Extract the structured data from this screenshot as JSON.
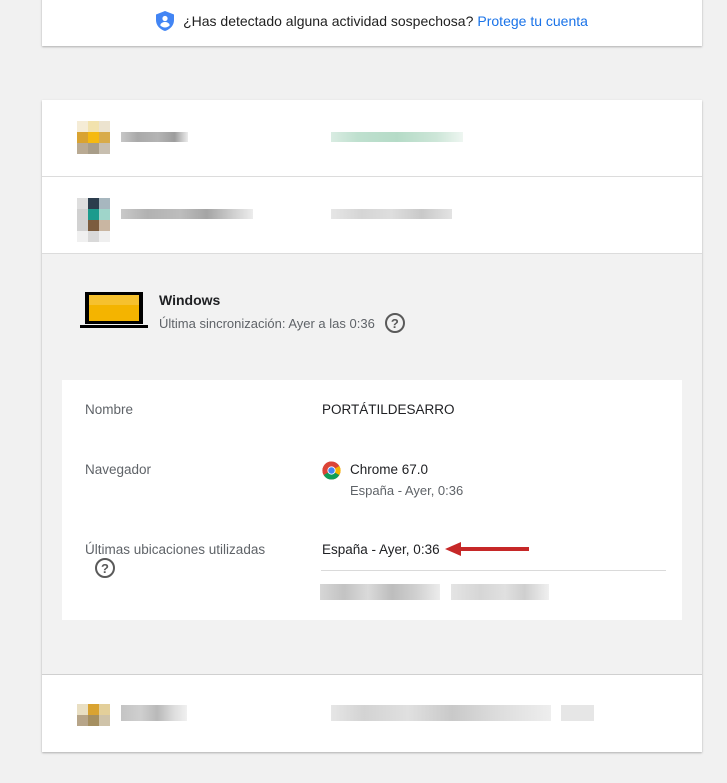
{
  "alert": {
    "question": "¿Has detectado alguna actividad sospechosa?",
    "link": "Protege tu cuenta"
  },
  "device": {
    "name": "Windows",
    "sync": "Última sincronización: Ayer a las 0:36",
    "details": {
      "name_label": "Nombre",
      "name_value": "PORTÁTILDESARRO",
      "browser_label": "Navegador",
      "browser_value": "Chrome 67.0",
      "browser_sub": "España - Ayer, 0:36",
      "locations_label": "Últimas ubicaciones utilizadas",
      "locations_value": "España - Ayer, 0:36"
    }
  },
  "icons": {
    "shield": "shield-account-icon",
    "laptop": "laptop-icon",
    "help": "help-circle-icon",
    "chrome": "chrome-icon",
    "arrow": "red-arrow-annotation"
  },
  "colors": {
    "link": "#1a73e8",
    "shield": "#4285f4",
    "laptop": "#f4b400",
    "arrow": "#c62828"
  }
}
